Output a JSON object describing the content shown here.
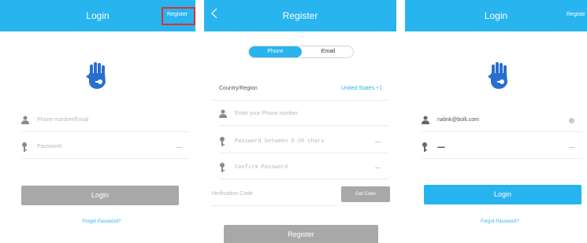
{
  "login": {
    "title": "Login",
    "register_label": "Register",
    "phone_placeholder": "Phone number/Email",
    "password_placeholder": "Password",
    "login_button": "Login",
    "forgot_label": "Forgot Password?"
  },
  "register": {
    "title": "Register",
    "tabs": [
      "Phone",
      "Email"
    ],
    "country_label": "Country/Region",
    "country_value": "United States +1",
    "phone_placeholder": "Enter your Phone number",
    "password_placeholder": "Password between 6-20 chars",
    "confirm_placeholder": "Confirm Password",
    "code_placeholder": "Verification Code",
    "get_code_button": "Get Code",
    "register_button": "Register"
  },
  "login_filled": {
    "title": "Login",
    "register_label": "Registe",
    "email_value": "nalink@bolli.com",
    "password_mask": "••••••••••••",
    "login_button": "Login",
    "forgot_label": "Forgot Password?"
  },
  "colors": {
    "accent": "#28b4ee",
    "button_disabled": "#a8a8a8",
    "highlight_box": "#e0302b"
  },
  "icons": [
    "hand-key-icon",
    "person-icon",
    "key-icon",
    "back-arrow-icon",
    "clear-icon",
    "eye-icon"
  ]
}
